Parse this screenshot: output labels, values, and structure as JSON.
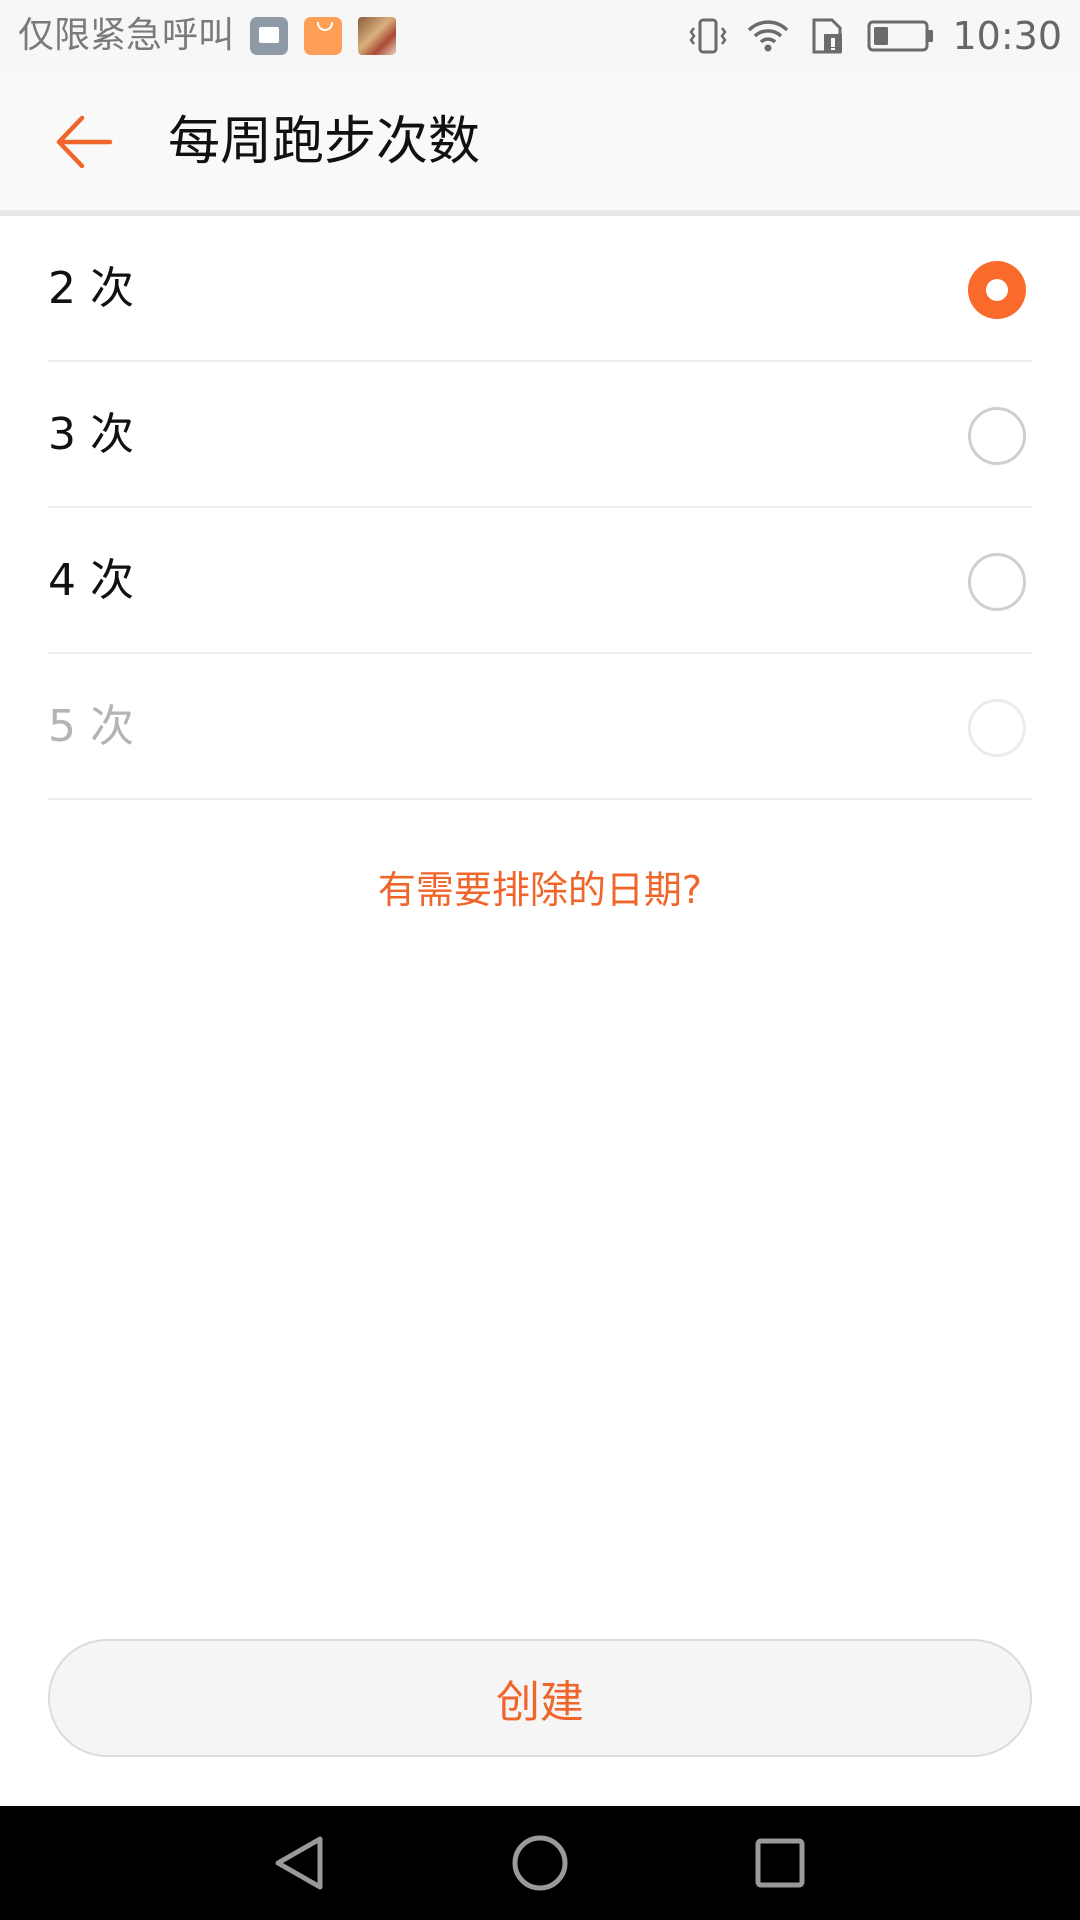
{
  "status_bar": {
    "carrier_text": "仅限紧急呼叫",
    "time": "10:30",
    "notification_icons": [
      "gallery-icon",
      "shopping-bag-icon",
      "photo-thumbnail-icon"
    ],
    "system_icons": [
      "vibrate-icon",
      "wifi-icon",
      "sim-icon",
      "battery-icon"
    ]
  },
  "header": {
    "back_icon": "arrow-left-icon",
    "title": "每周跑步次数"
  },
  "options": [
    {
      "label": "2 次",
      "selected": true,
      "enabled": true
    },
    {
      "label": "3 次",
      "selected": false,
      "enabled": true
    },
    {
      "label": "4 次",
      "selected": false,
      "enabled": true
    },
    {
      "label": "5 次",
      "selected": false,
      "enabled": false
    }
  ],
  "exclude_link": "有需要排除的日期?",
  "create_button": "创建",
  "nav_bar": {
    "icons": [
      "nav-back-icon",
      "nav-home-icon",
      "nav-recents-icon"
    ]
  },
  "colors": {
    "accent": "#f96a2b",
    "text_primary": "#111111",
    "text_disabled": "#b4b4b4",
    "divider": "#ededed",
    "nav_bar": "#000000"
  }
}
